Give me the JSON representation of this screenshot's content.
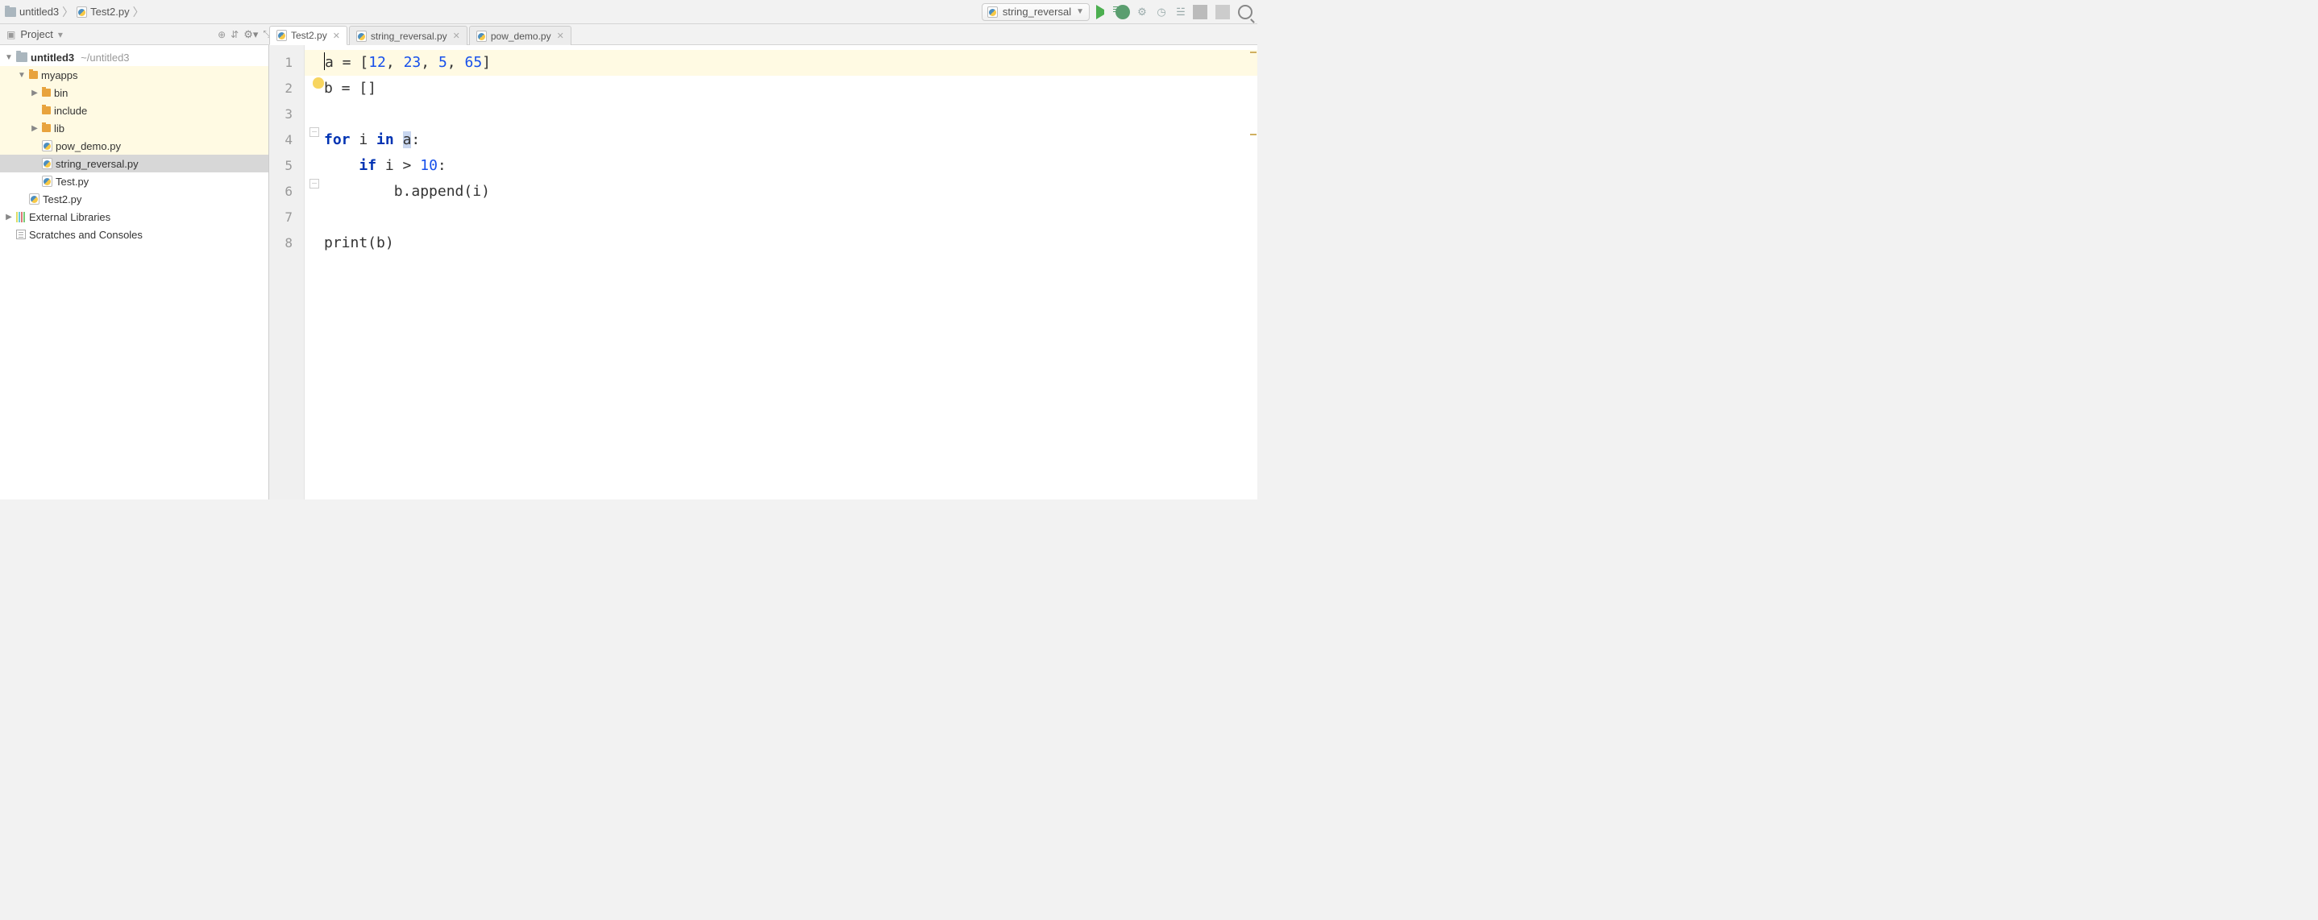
{
  "breadcrumb": {
    "root": "untitled3",
    "file": "Test2.py"
  },
  "run_config": {
    "label": "string_reversal"
  },
  "toolwindow": {
    "title": "Project"
  },
  "tree": {
    "root": {
      "name": "untitled3",
      "path": "~/untitled3"
    },
    "myapps": "myapps",
    "bin": "bin",
    "include": "include",
    "lib": "lib",
    "pow_demo": "pow_demo.py",
    "string_reversal": "string_reversal.py",
    "test": "Test.py",
    "test2": "Test2.py",
    "ext_lib": "External Libraries",
    "scratches": "Scratches and Consoles"
  },
  "tabs": [
    {
      "label": "Test2.py",
      "active": true
    },
    {
      "label": "string_reversal.py",
      "active": false
    },
    {
      "label": "pow_demo.py",
      "active": false
    }
  ],
  "editor": {
    "gutter": [
      "1",
      "2",
      "3",
      "4",
      "5",
      "6",
      "7",
      "8"
    ],
    "code": {
      "l1": {
        "a": "a",
        "eq": " = [",
        "n1": "12",
        "c1": ", ",
        "n2": "23",
        "c2": ", ",
        "n3": "5",
        "c3": ", ",
        "n4": "65",
        "end": "]"
      },
      "l2": "b = []",
      "l4": {
        "for": "for",
        "sp1": " i ",
        "in": "in",
        "sp2": " ",
        "a": "a",
        "colon": ":"
      },
      "l5": {
        "indent": "    ",
        "if": "if",
        "cond": " i > ",
        "n": "10",
        "colon": ":"
      },
      "l6": "        b.append(i)",
      "l8": "print(b)"
    }
  }
}
